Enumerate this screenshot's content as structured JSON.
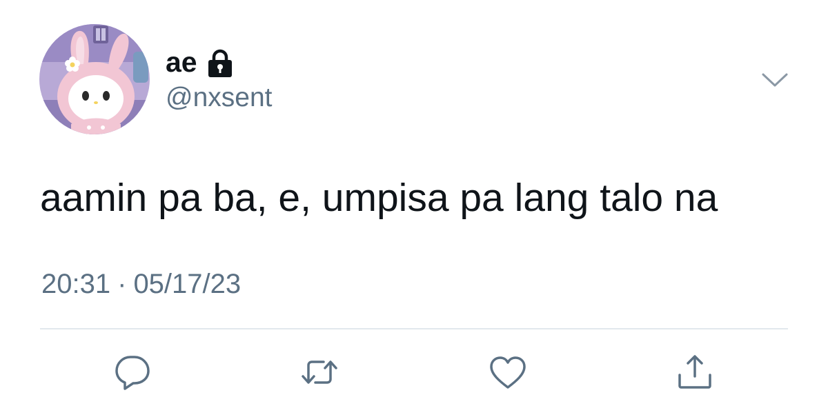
{
  "user": {
    "display_name": "ae",
    "protected_icon": "lock-icon",
    "handle": "@nxsent",
    "avatar": "avatar-image"
  },
  "tweet": {
    "text": "aamin pa ba, e, umpisa pa lang talo na",
    "time": "20:31",
    "separator": "·",
    "date": "05/17/23"
  },
  "menu": {
    "icon": "chevron-down-icon"
  },
  "actions": [
    {
      "name": "reply",
      "icon": "reply-icon"
    },
    {
      "name": "retweet",
      "icon": "retweet-icon"
    },
    {
      "name": "like",
      "icon": "heart-icon"
    },
    {
      "name": "share",
      "icon": "share-icon"
    }
  ],
  "colors": {
    "primary_text": "#0f1419",
    "secondary_text": "#5b7083",
    "divider": "#e1e8ed"
  }
}
